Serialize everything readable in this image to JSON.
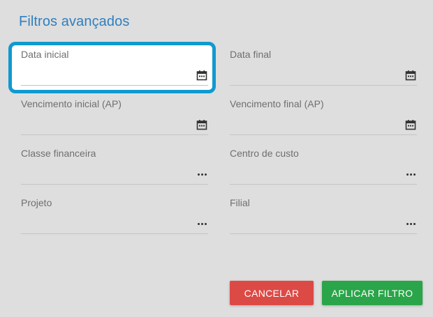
{
  "dialog": {
    "title": "Filtros avançados"
  },
  "fields": {
    "data_inicial": {
      "label": "Data inicial",
      "value": "",
      "icon": "calendar-icon"
    },
    "data_final": {
      "label": "Data final",
      "value": "",
      "icon": "calendar-icon"
    },
    "vencimento_inicial": {
      "label": "Vencimento inicial (AP)",
      "value": "",
      "icon": "calendar-icon"
    },
    "vencimento_final": {
      "label": "Vencimento final (AP)",
      "value": "",
      "icon": "calendar-icon"
    },
    "classe_financeira": {
      "label": "Classe financeira",
      "value": "",
      "icon": "more-dots-icon"
    },
    "centro_de_custo": {
      "label": "Centro de custo",
      "value": "",
      "icon": "more-dots-icon"
    },
    "projeto": {
      "label": "Projeto",
      "value": "",
      "icon": "more-dots-icon"
    },
    "filial": {
      "label": "Filial",
      "value": "",
      "icon": "more-dots-icon"
    }
  },
  "buttons": {
    "cancel_label": "CANCELAR",
    "apply_label": "APLICAR FILTRO"
  },
  "colors": {
    "title": "#2f7fc0",
    "focus_ring": "#0f9ad0",
    "cancel": "#dc4a45",
    "apply": "#2aa549",
    "background": "#dedede"
  }
}
